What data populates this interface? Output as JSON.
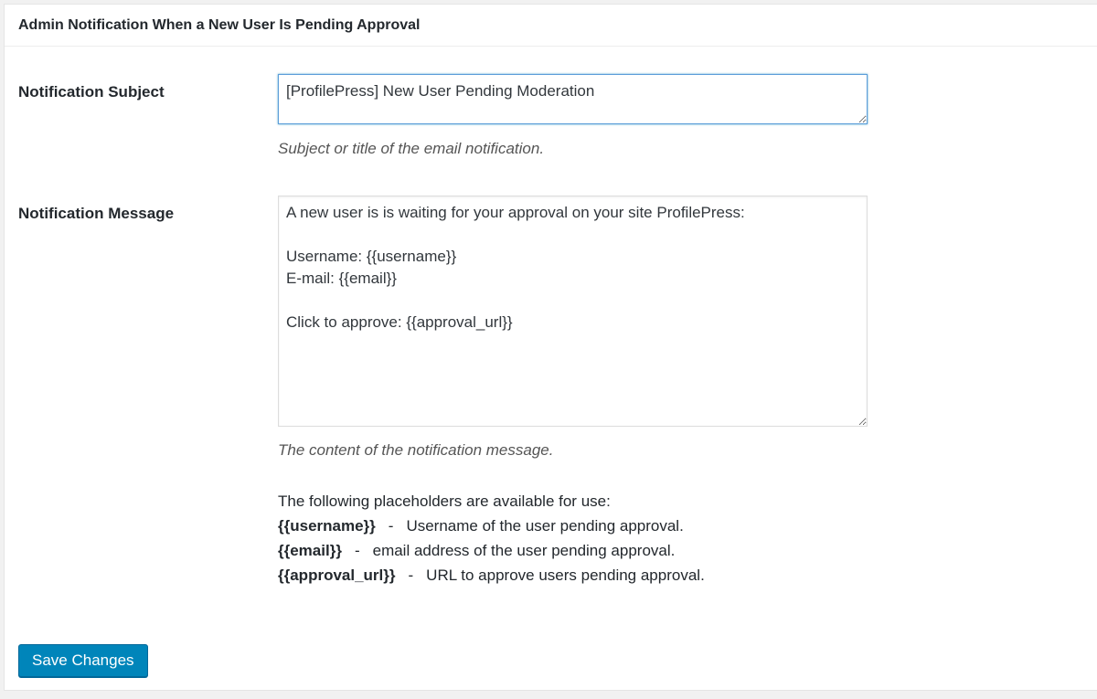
{
  "section": {
    "title": "Admin Notification When a New User Is Pending Approval"
  },
  "subject": {
    "label": "Notification Subject",
    "value": "[ProfilePress] New User Pending Moderation",
    "description": "Subject or title of the email notification."
  },
  "message": {
    "label": "Notification Message",
    "value": "A new user is is waiting for your approval on your site ProfilePress:\n\nUsername: {{username}}\nE-mail: {{email}}\n\nClick to approve: {{approval_url}}",
    "description": "The content of the notification message."
  },
  "placeholders": {
    "intro": "The following placeholders are available for use:",
    "separator": "-",
    "items": [
      {
        "tag": "{{username}}",
        "text": "Username of the user pending approval."
      },
      {
        "tag": "{{email}}",
        "text": "email address of the user pending approval."
      },
      {
        "tag": "{{approval_url}}",
        "text": "URL to approve users pending approval."
      }
    ]
  },
  "save_button": {
    "label": "Save Changes"
  }
}
